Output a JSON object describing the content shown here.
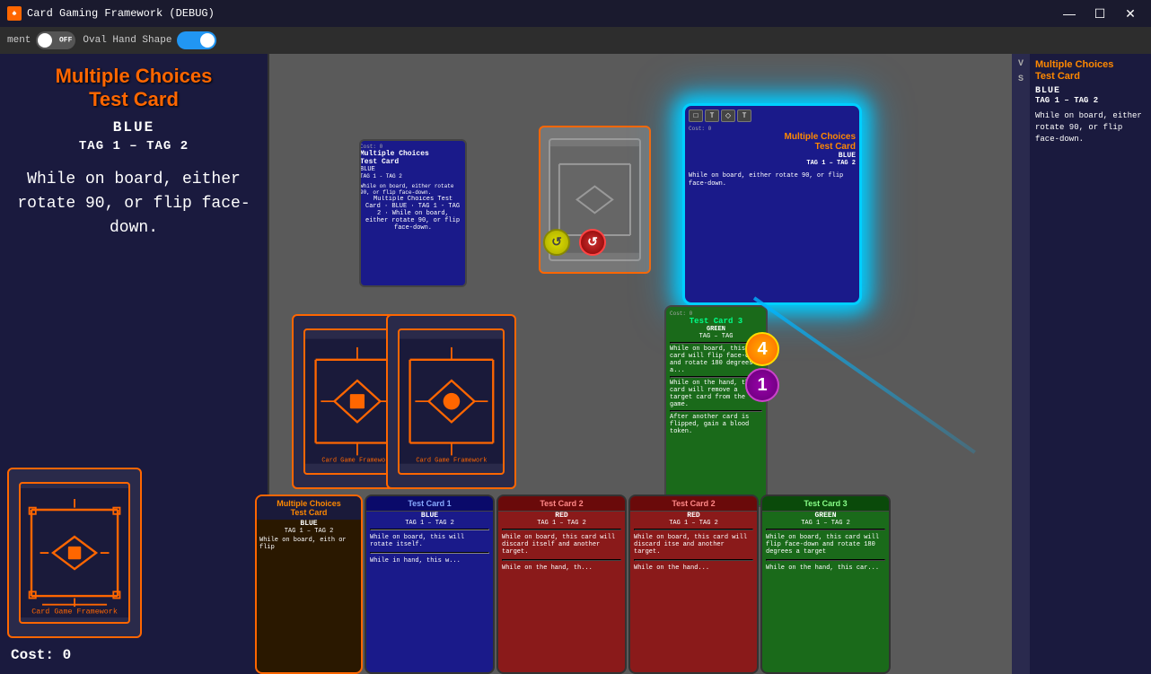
{
  "titlebar": {
    "title": "Card Gaming Framework (DEBUG)",
    "min": "—",
    "max": "☐",
    "close": "✕"
  },
  "menu": {
    "toggle1_label": "ment",
    "toggle1_state": "OFF",
    "toggle2_label": "Oval Hand Shape",
    "toggle2_state": "ON"
  },
  "left_panel": {
    "title": "Multiple Choices\nTest Card",
    "color": "BLUE",
    "tags": "TAG 1 – TAG 2",
    "body": "While on board, either rotate 90, or flip face-down.",
    "cost": "Cost: 0"
  },
  "right_panel": {
    "v_label": "V",
    "s_label": "S",
    "title": "Multiple Choices\nTest Card",
    "color": "BLUE",
    "tags": "TAG 1 – TAG 2",
    "body": "While on board, either rotate 90, or flip face-down."
  },
  "cards": {
    "test_card_3": {
      "title": "Test Card 3",
      "color": "GREEN",
      "tags": "TAG – TAG",
      "body1": "While on board, this card will flip face-down and rotate 180 degrees a...",
      "body2": "While on the hand, this card will remove a target card from the game.",
      "body3": "After another card is flipped, gain a blood token.",
      "cost": "Cost: 0"
    },
    "hand": [
      {
        "title": "Multiple Choices\nTest Card",
        "color": "BLUE",
        "tags": "TAG 1 – TAG 2",
        "body": "While on board, eith or flip",
        "type": "orange"
      },
      {
        "title": "Test Card 1",
        "color": "BLUE",
        "tags": "TAG 1 – TAG 2",
        "body": "While on board, this will rotate itself.",
        "body2": "While in hand, this w...",
        "type": "blue"
      },
      {
        "title": "Test Card 2",
        "color": "RED",
        "tags": "TAG 1 – TAG 2",
        "body": "While on board, this card will discard itself and another target.",
        "body2": "While on the hand, th...",
        "type": "red"
      },
      {
        "title": "Test Card 2",
        "color": "RED",
        "tags": "TAG 1 – TAG 2",
        "body": "While on board, this card will discard itse and another target.",
        "body2": "While on the hand...",
        "type": "red"
      },
      {
        "title": "Test Card 3",
        "color": "GREEN",
        "tags": "TAG 1 – TAG 2",
        "body": "While on board, this card will flip face-down and rotate 180 degrees a target",
        "body2": "While on the hand, this car...",
        "type": "green"
      }
    ]
  },
  "glow_card": {
    "title": "Multiple Choices Test Card",
    "color": "BLUE",
    "tags": "TAG 1 – TAG 2",
    "body": "While on board, either rotate 90, or flip face-down.",
    "cost": "Cost: 0"
  },
  "another_text": "and another"
}
